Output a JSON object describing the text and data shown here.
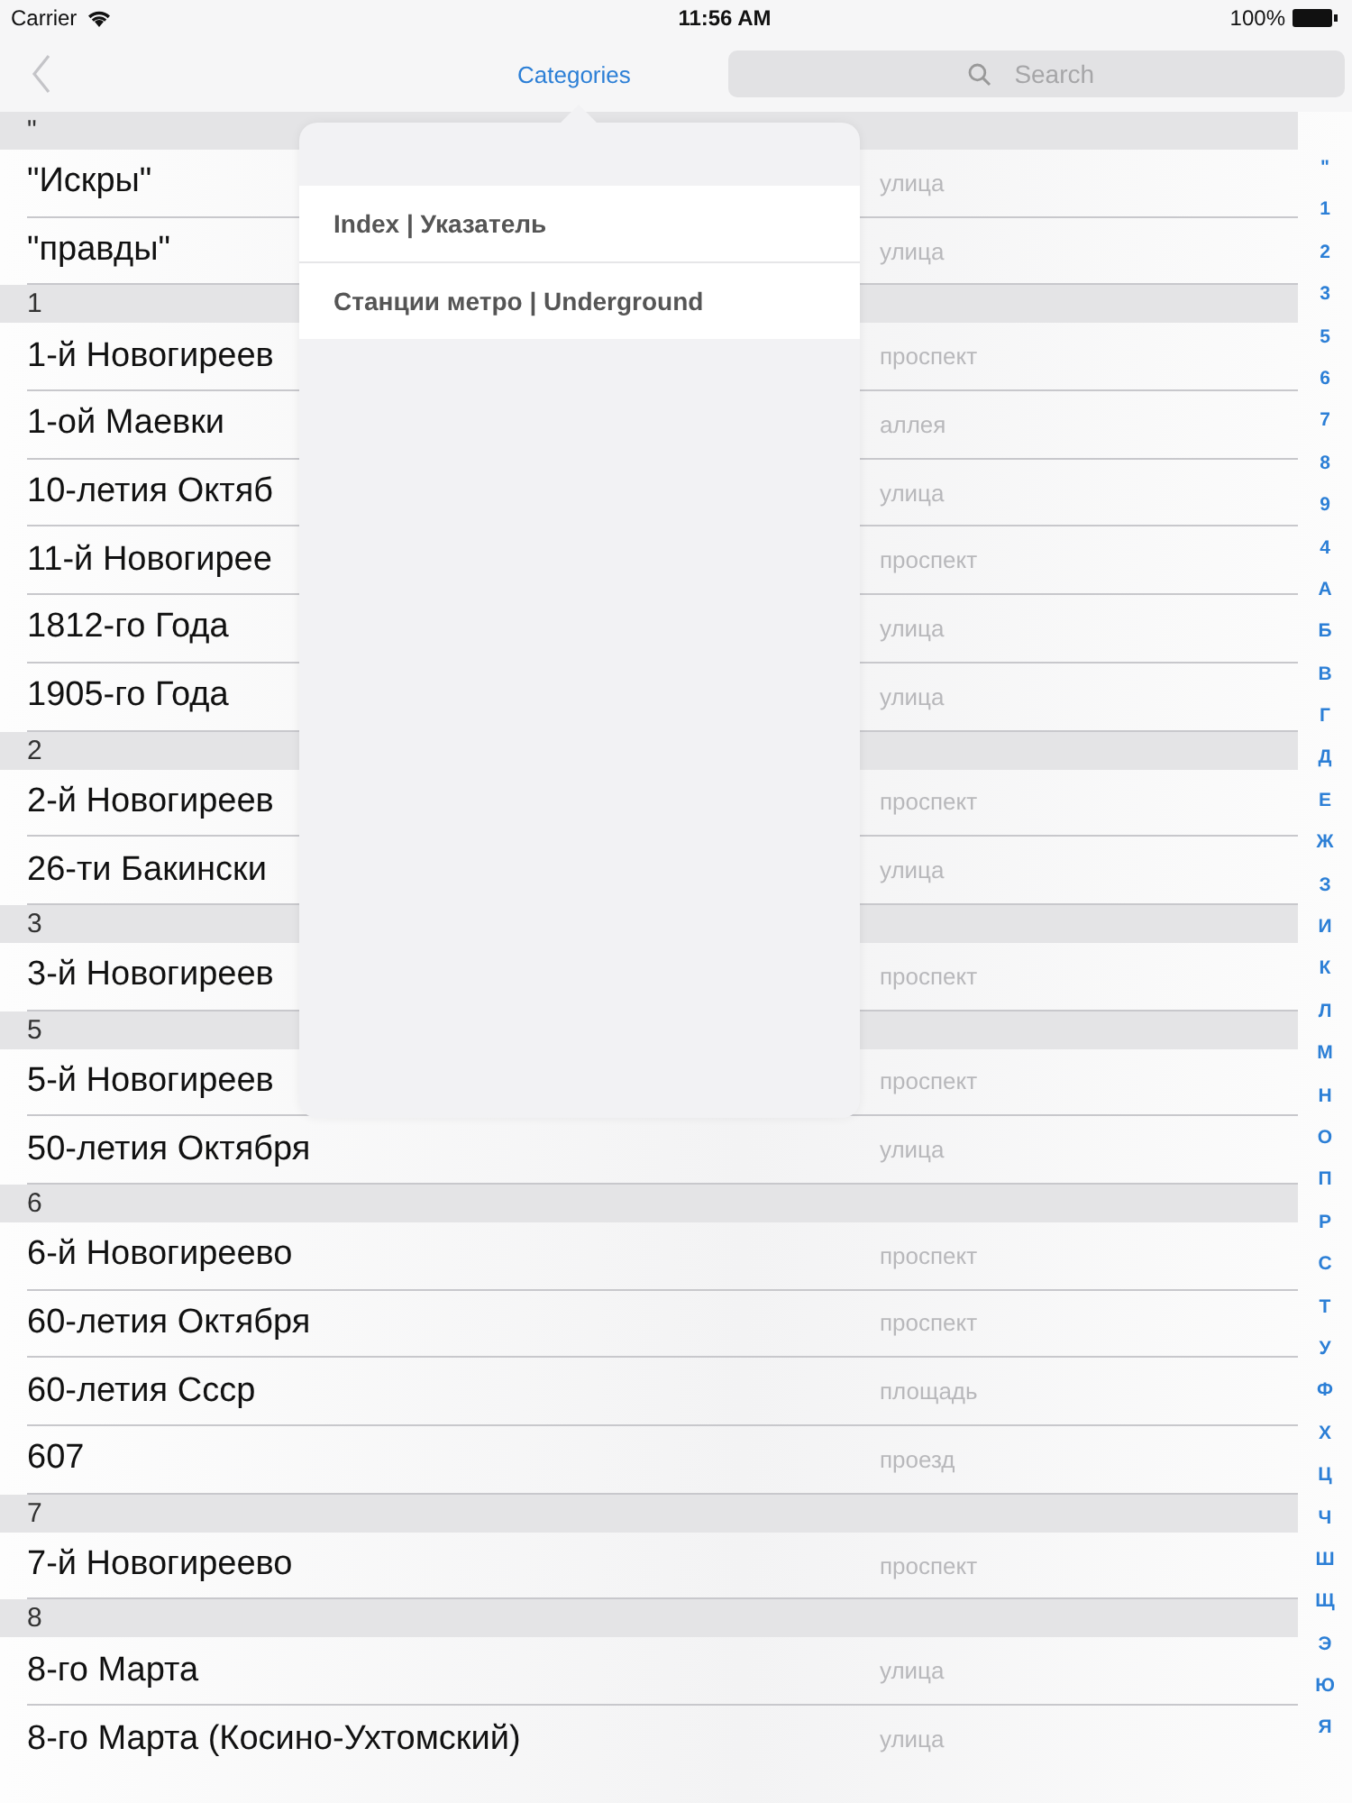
{
  "status_bar": {
    "carrier": "Carrier",
    "time": "11:56 AM",
    "battery": "100%"
  },
  "nav": {
    "title": "Categories",
    "search": {
      "placeholder": "Search"
    }
  },
  "popover": {
    "items": [
      {
        "label": "Index | Указатель"
      },
      {
        "label": "Станции метро | Underground"
      }
    ]
  },
  "sections": [
    {
      "header": "\"",
      "rows": [
        {
          "name": "\"Искры\"",
          "type": "улица"
        },
        {
          "name": "\"правды\"",
          "type": "улица"
        }
      ]
    },
    {
      "header": "1",
      "rows": [
        {
          "name": "1-й Новогиреев",
          "type": "проспект"
        },
        {
          "name": "1-ой Маевки",
          "type": "аллея"
        },
        {
          "name": "10-летия Октяб",
          "type": "улица"
        },
        {
          "name": "11-й Новогирее",
          "type": "проспект"
        },
        {
          "name": "1812-го Года",
          "type": "улица"
        },
        {
          "name": "1905-го Года",
          "type": "улица"
        }
      ]
    },
    {
      "header": "2",
      "rows": [
        {
          "name": "2-й Новогиреев",
          "type": "проспект"
        },
        {
          "name": "26-ти Бакински",
          "type": "улица"
        }
      ]
    },
    {
      "header": "3",
      "rows": [
        {
          "name": "3-й Новогиреев",
          "type": "проспект"
        }
      ]
    },
    {
      "header": "5",
      "rows": [
        {
          "name": "5-й Новогиреев",
          "type": "проспект"
        },
        {
          "name": "50-летия Октября",
          "type": "улица"
        }
      ]
    },
    {
      "header": "6",
      "rows": [
        {
          "name": "6-й Новогиреево",
          "type": "проспект"
        },
        {
          "name": "60-летия Октября",
          "type": "проспект"
        },
        {
          "name": "60-летия Ссср",
          "type": "площадь"
        },
        {
          "name": "607",
          "type": "проезд"
        }
      ]
    },
    {
      "header": "7",
      "rows": [
        {
          "name": "7-й Новогиреево",
          "type": "проспект"
        }
      ]
    },
    {
      "header": "8",
      "rows": [
        {
          "name": "8-го Марта",
          "type": "улица"
        },
        {
          "name": "8-го Марта (Косино-Ухтомский)",
          "type": "улица"
        }
      ]
    }
  ],
  "index": [
    "\"",
    "1",
    "2",
    "3",
    "5",
    "6",
    "7",
    "8",
    "9",
    "4",
    "А",
    "Б",
    "В",
    "Г",
    "Д",
    "Е",
    "Ж",
    "З",
    "И",
    "К",
    "Л",
    "М",
    "Н",
    "О",
    "П",
    "Р",
    "С",
    "Т",
    "У",
    "Ф",
    "Х",
    "Ц",
    "Ч",
    "Ш",
    "Щ",
    "Э",
    "Ю",
    "Я"
  ]
}
